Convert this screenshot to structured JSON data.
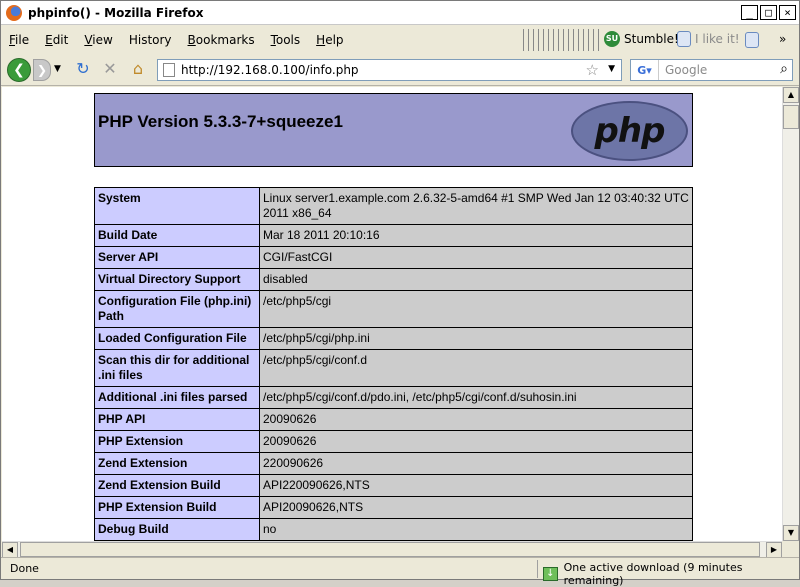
{
  "window": {
    "title": "phpinfo() - Mozilla Firefox"
  },
  "menubar": {
    "items": [
      {
        "label": "File",
        "u": "F",
        "rest": "ile"
      },
      {
        "label": "Edit",
        "u": "E",
        "rest": "dit"
      },
      {
        "label": "View",
        "u": "V",
        "rest": "iew"
      },
      {
        "label": "History",
        "u": "H",
        "rest": "istory"
      },
      {
        "label": "Bookmarks",
        "u": "B",
        "rest": "ookmarks"
      },
      {
        "label": "Tools",
        "u": "T",
        "rest": "ools"
      },
      {
        "label": "Help",
        "u": "H",
        "rest": "elp"
      }
    ],
    "stumble_label": "Stumble!",
    "likeit_label": "I like it!",
    "more_label": "»"
  },
  "navbar": {
    "url": "http://192.168.0.100/info.php",
    "search_placeholder": "Google"
  },
  "page": {
    "heading": "PHP Version 5.3.3-7+squeeze1",
    "logo_text": "php",
    "rows": [
      {
        "key": "System",
        "value": "Linux server1.example.com 2.6.32-5-amd64 #1 SMP Wed Jan 12 03:40:32 UTC 2011 x86_64"
      },
      {
        "key": "Build Date",
        "value": "Mar 18 2011 20:10:16"
      },
      {
        "key": "Server API",
        "value": "CGI/FastCGI"
      },
      {
        "key": "Virtual Directory Support",
        "value": "disabled"
      },
      {
        "key": "Configuration File (php.ini) Path",
        "value": "/etc/php5/cgi"
      },
      {
        "key": "Loaded Configuration File",
        "value": "/etc/php5/cgi/php.ini"
      },
      {
        "key": "Scan this dir for additional .ini files",
        "value": "/etc/php5/cgi/conf.d"
      },
      {
        "key": "Additional .ini files parsed",
        "value": "/etc/php5/cgi/conf.d/pdo.ini, /etc/php5/cgi/conf.d/suhosin.ini"
      },
      {
        "key": "PHP API",
        "value": "20090626"
      },
      {
        "key": "PHP Extension",
        "value": "20090626"
      },
      {
        "key": "Zend Extension",
        "value": "220090626"
      },
      {
        "key": "Zend Extension Build",
        "value": "API220090626,NTS"
      },
      {
        "key": "PHP Extension Build",
        "value": "API20090626,NTS"
      },
      {
        "key": "Debug Build",
        "value": "no"
      }
    ]
  },
  "statusbar": {
    "status": "Done",
    "download": "One active download (9 minutes remaining)"
  }
}
